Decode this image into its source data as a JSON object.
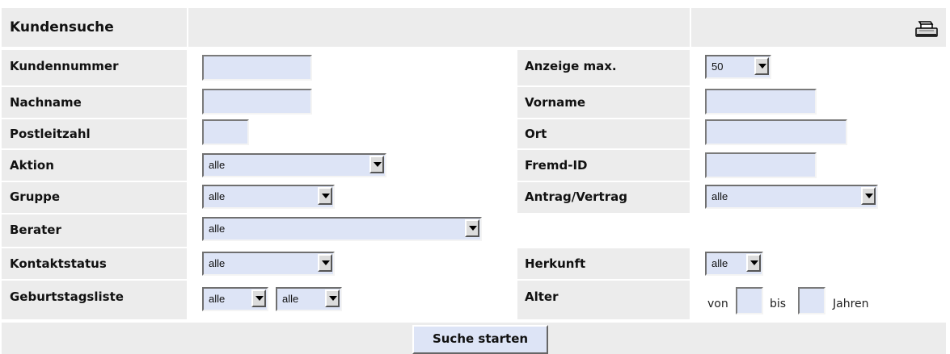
{
  "header": {
    "title": "Kundensuche",
    "print_icon": "printer-icon"
  },
  "fields": {
    "kundennummer": {
      "label": "Kundennummer",
      "value": ""
    },
    "anzeige_max": {
      "label": "Anzeige max.",
      "value": "50"
    },
    "nachname": {
      "label": "Nachname",
      "value": ""
    },
    "vorname": {
      "label": "Vorname",
      "value": ""
    },
    "postleitzahl": {
      "label": "Postleitzahl",
      "value": ""
    },
    "ort": {
      "label": "Ort",
      "value": ""
    },
    "aktion": {
      "label": "Aktion",
      "value": "alle"
    },
    "fremd_id": {
      "label": "Fremd-ID",
      "value": ""
    },
    "gruppe": {
      "label": "Gruppe",
      "value": "alle"
    },
    "antrag_vertrag": {
      "label": "Antrag/Vertrag",
      "value": "alle"
    },
    "berater": {
      "label": "Berater",
      "value": "alle"
    },
    "kontaktstatus": {
      "label": "Kontaktstatus",
      "value": "alle"
    },
    "herkunft": {
      "label": "Herkunft",
      "value": "alle"
    },
    "geburtstagsliste": {
      "label": "Geburtstagsliste",
      "value1": "alle",
      "value2": "alle"
    },
    "alter": {
      "label": "Alter",
      "von": "von",
      "bis": "bis",
      "jahren": "Jahren"
    }
  },
  "submit_label": "Suche starten"
}
